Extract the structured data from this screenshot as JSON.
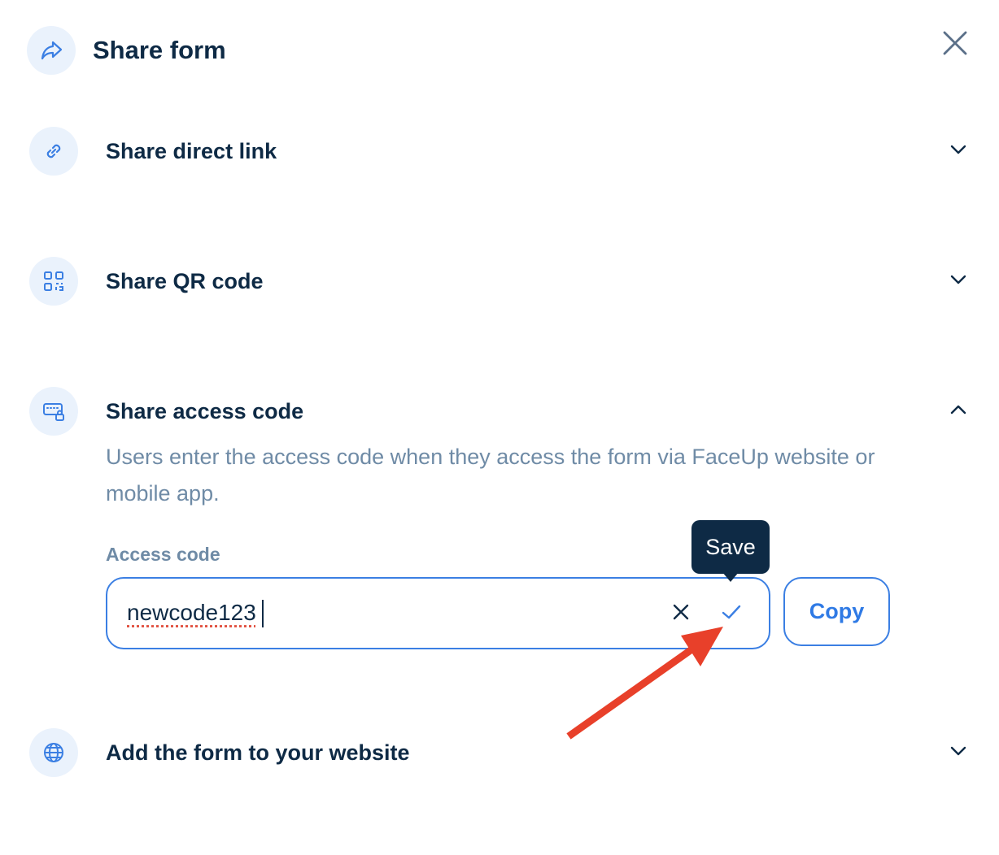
{
  "header": {
    "title": "Share form",
    "icon": "share-arrow-icon",
    "close_icon": "close-icon"
  },
  "sections": [
    {
      "title": "Share direct link",
      "icon": "link-icon",
      "expanded": false
    },
    {
      "title": "Share QR code",
      "icon": "qr-code-icon",
      "expanded": false
    },
    {
      "title": "Share access code",
      "icon": "keyboard-lock-icon",
      "expanded": true,
      "description": "Users enter the access code when they access the form via FaceUp website or mobile app.",
      "field": {
        "label": "Access code",
        "value": "newcode123",
        "tooltip": "Save",
        "copy_label": "Copy"
      }
    },
    {
      "title": "Add the form to your website",
      "icon": "globe-icon",
      "expanded": false
    }
  ],
  "colors": {
    "primary_text": "#0e2a45",
    "muted_text": "#6f8ba6",
    "accent_blue": "#3b7fe3",
    "icon_bg": "#eaf2fc",
    "annotation_red": "#e8402a"
  }
}
